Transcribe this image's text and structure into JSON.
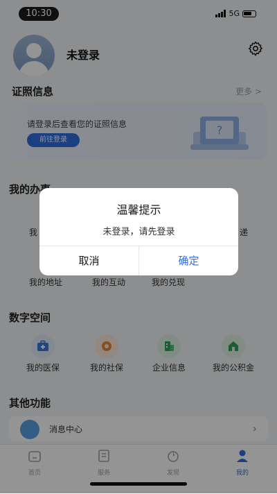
{
  "status_bar": {
    "time": "10:30",
    "network": "5G"
  },
  "header": {
    "username": "未登录"
  },
  "certificates": {
    "title": "证照信息",
    "more": "更多 >",
    "hint": "请登录后查看您的证照信息",
    "button": "前往登录"
  },
  "my_tasks": {
    "title": "我的办事",
    "partial_left": "我",
    "partial_right": "递",
    "items": [
      "我的地址",
      "我的互动",
      "我的兑现"
    ]
  },
  "digital_space": {
    "title": "数字空间",
    "items": [
      {
        "label": "我的医保",
        "icon": "medical-kit-icon",
        "color": "#3a78d8"
      },
      {
        "label": "我的社保",
        "icon": "social-security-icon",
        "color": "#e68a3a"
      },
      {
        "label": "企业信息",
        "icon": "enterprise-icon",
        "color": "#2fa35a"
      },
      {
        "label": "我的公积金",
        "icon": "housing-fund-icon",
        "color": "#2fa35a"
      }
    ]
  },
  "other": {
    "title": "其他功能",
    "message_center": "消息中心"
  },
  "tabbar": {
    "tabs": [
      {
        "label": "首页",
        "active": false
      },
      {
        "label": "服务",
        "active": false
      },
      {
        "label": "发现",
        "active": false
      },
      {
        "label": "我的",
        "active": true
      }
    ]
  },
  "dialog": {
    "title": "温馨提示",
    "message": "未登录，请先登录",
    "cancel": "取消",
    "confirm": "确定"
  },
  "colors": {
    "accent": "#2f6fe0",
    "overlay": "rgba(0,0,0,0.42)"
  }
}
